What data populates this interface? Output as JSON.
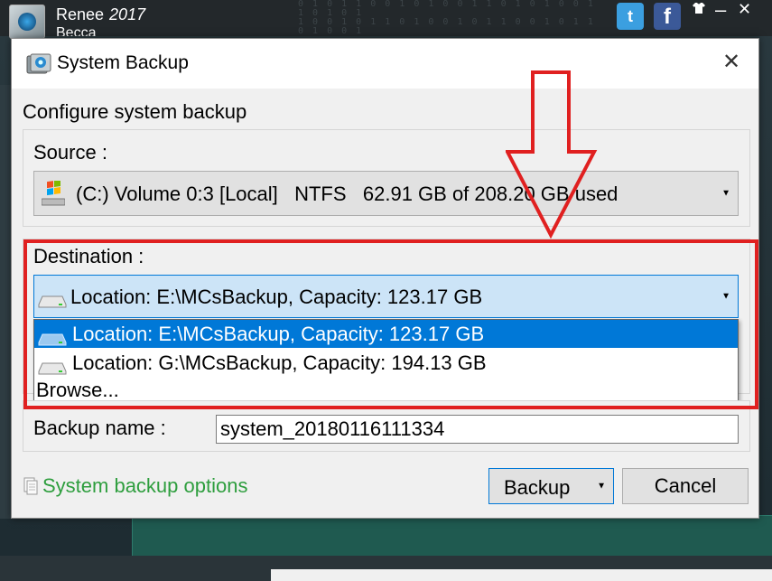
{
  "background_app": {
    "title": "Renee",
    "year": "2017",
    "subtitle": "Becca",
    "twitter_glyph": "t",
    "facebook_glyph": "f"
  },
  "dialog": {
    "title": "System Backup",
    "close_glyph": "✕",
    "heading": "Configure system backup",
    "source": {
      "label": "Source :",
      "value": "(C:) Volume 0:3 [Local]   NTFS   62.91 GB of 208.20 GB used"
    },
    "destination": {
      "label": "Destination :",
      "selected": "Location: E:\\MCsBackup, Capacity: 123.17 GB",
      "options": [
        {
          "label": "Location: E:\\MCsBackup, Capacity: 123.17 GB",
          "selected": true,
          "icon": "drive-icon"
        },
        {
          "label": "Location: G:\\MCsBackup, Capacity: 194.13 GB",
          "selected": false,
          "icon": "drive-icon"
        },
        {
          "label": "Browse...",
          "selected": false
        }
      ]
    },
    "backup_name": {
      "label": "Backup name :",
      "value": "system_20180116111334"
    },
    "options_link": "System backup options",
    "buttons": {
      "backup": "Backup",
      "cancel": "Cancel"
    }
  },
  "colors": {
    "accent": "#0078d7",
    "annotation": "#e02020",
    "link": "#2e9e3e"
  }
}
